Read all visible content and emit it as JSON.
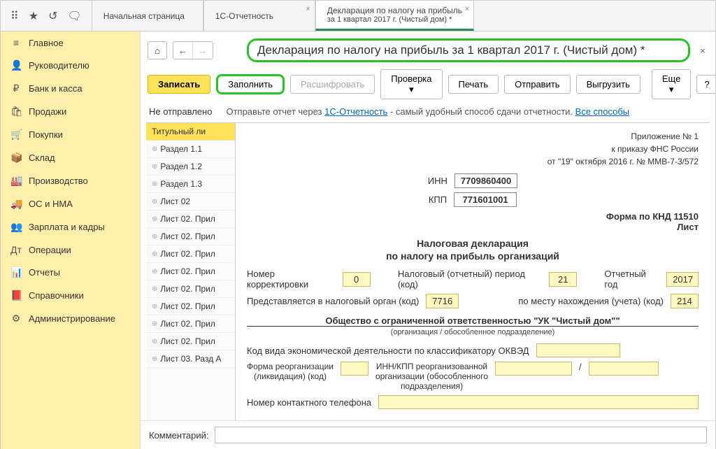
{
  "tabs": {
    "t1": "Начальная страница",
    "t2": "1С-Отчетность",
    "t3a": "Декларация по налогу на прибыль",
    "t3b": "за 1 квартал 2017 г. (Чистый дом) *"
  },
  "sidebar": [
    {
      "icon": "≡",
      "label": "Главное"
    },
    {
      "icon": "👤",
      "label": "Руководителю"
    },
    {
      "icon": "₽",
      "label": "Банк и касса"
    },
    {
      "icon": "🛍",
      "label": "Продажи"
    },
    {
      "icon": "🛒",
      "label": "Покупки"
    },
    {
      "icon": "📦",
      "label": "Склад"
    },
    {
      "icon": "🏭",
      "label": "Производство"
    },
    {
      "icon": "🚚",
      "label": "ОС и НМА"
    },
    {
      "icon": "👥",
      "label": "Зарплата и кадры"
    },
    {
      "icon": "Дᴛ",
      "label": "Операции"
    },
    {
      "icon": "📊",
      "label": "Отчеты"
    },
    {
      "icon": "📕",
      "label": "Справочники"
    },
    {
      "icon": "⚙",
      "label": "Администрирование"
    }
  ],
  "pageTitle": "Декларация по налогу на прибыль за 1 квартал 2017 г. (Чистый дом) *",
  "buttons": {
    "save": "Записать",
    "fill": "Заполнить",
    "decode": "Расшифровать",
    "check": "Проверка",
    "print": "Печать",
    "send": "Отправить",
    "export": "Выгрузить",
    "more": "Еще",
    "help": "?"
  },
  "status": {
    "state": "Не отправлено",
    "msg_pre": "Отправьте отчет через ",
    "msg_link1": "1С-Отчетность",
    "msg_mid": " - самый удобный способ сдачи отчетности. ",
    "msg_link2": "Все способы"
  },
  "tree": [
    "Титульный ли",
    "Раздел 1.1",
    "Раздел 1.2",
    "Раздел 1.3",
    "Лист 02",
    "Лист 02. Прил",
    "Лист 02. Прил",
    "Лист 02. Прил",
    "Лист 02. Прил",
    "Лист 02. Прил",
    "Лист 02. Прил",
    "Лист 02. Прил",
    "Лист 02. Прил",
    "Лист 03. Разд А"
  ],
  "form": {
    "hdr1": "Приложение № 1",
    "hdr2": "к приказу ФНС России",
    "hdr3": "от \"19\" октября 2016 г. № ММВ-7-3/572",
    "inn_l": "ИНН",
    "inn_v": "7709860400",
    "kpp_l": "КПП",
    "kpp_v": "771601001",
    "knd": "Форма по КНД 11510",
    "list": "Лист",
    "title": "Налоговая декларация",
    "subtitle": "по налогу на прибыль организаций",
    "corr_l": "Номер корректировки",
    "corr_v": "0",
    "period_l": "Налоговый (отчетный) период (код)",
    "period_v": "21",
    "year_l": "Отчетный год",
    "year_v": "2017",
    "organ_l": "Представляется в налоговый орган (код)",
    "organ_v": "7716",
    "place_l": "по месту нахождения (учета) (код)",
    "place_v": "214",
    "org_name": "Общество с ограниченной ответственностью \"УК \"Чистый дом\"\"",
    "org_sub": "(организация / обособленное подразделение)",
    "okved_l": "Код вида экономической деятельности по классификатору ОКВЭД",
    "reorg_l1": "Форма реорганизации",
    "reorg_l2": "(ликвидация) (код)",
    "reorg_r1": "ИНН/КПП реорганизованной",
    "reorg_r2": "организации (обособленного",
    "reorg_r3": "подразделения)",
    "phone_l": "Номер контактного телефона"
  },
  "comments_l": "Комментарий:"
}
